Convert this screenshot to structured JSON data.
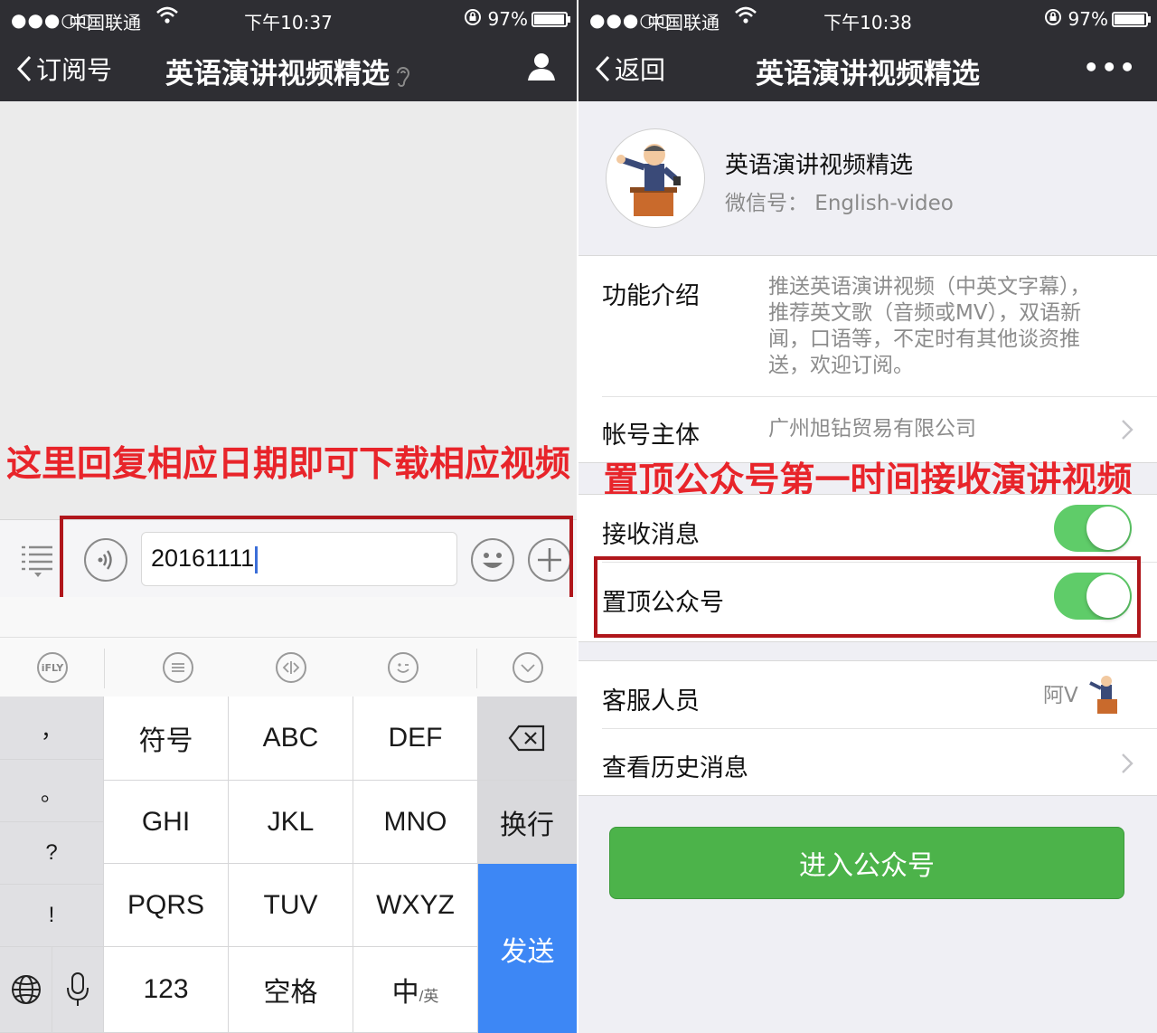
{
  "left_screen": {
    "status": {
      "signal": "●●●○○",
      "carrier": "中国联通",
      "time": "下午10:37",
      "battery": "97%",
      "battery_level": 0.97
    },
    "nav": {
      "back_label": "订阅号",
      "title": "英语演讲视频精选"
    },
    "annotation": "这里回复相应日期即可下载相应视频",
    "input": {
      "value": "20161111"
    },
    "toolbar_icons": [
      "ifly-icon",
      "chat-bubble-icon",
      "code-arrows-icon",
      "smile-wink-icon",
      "chevron-down-icon"
    ],
    "toolbar_ifly_text": "iFLY",
    "keyboard": {
      "side_keys": [
        "，",
        "。",
        "?",
        "!"
      ],
      "rows": [
        [
          "符号",
          "ABC",
          "DEF"
        ],
        [
          "GHI",
          "JKL",
          "MNO"
        ],
        [
          "PQRS",
          "TUV",
          "WXYZ"
        ]
      ],
      "bottom_keys": [
        "123",
        "空格"
      ],
      "lang_key_main": "中",
      "lang_key_sub": "/英",
      "return_key": "换行",
      "send_key": "发送"
    }
  },
  "right_screen": {
    "status": {
      "signal": "●●●○○",
      "carrier": "中国联通",
      "time": "下午10:38",
      "battery": "97%",
      "battery_level": 0.97
    },
    "nav": {
      "back_label": "返回",
      "title": "英语演讲视频精选",
      "more": "•••"
    },
    "profile": {
      "name": "英语演讲视频精选",
      "wechat_id": "微信号： English-video"
    },
    "intro": {
      "label": "功能介绍",
      "lines": [
        "推送英语演讲视频（中英文字幕），",
        "推荐英文歌（音频或MV），双语新",
        "闻，口语等，不定时有其他谈资推",
        "送，欢迎订阅。"
      ]
    },
    "owner": {
      "label": "帐号主体",
      "value": "广州旭钻贸易有限公司"
    },
    "annotation": "置顶公众号第一时间接收演讲视频",
    "receive_messages": {
      "label": "接收消息",
      "on": true
    },
    "pin_account": {
      "label": "置顶公众号",
      "on": true
    },
    "service": {
      "label": "客服人员",
      "value": "阿V"
    },
    "history": {
      "label": "查看历史消息"
    },
    "enter_button": "进入公众号"
  },
  "colors": {
    "nav_bg": "#2e2e33",
    "annotation_red": "#e8242a",
    "box_red": "#b0161b",
    "toggle_green": "#5fcc69",
    "button_green": "#4cb34a",
    "send_blue": "#3d87f5"
  }
}
